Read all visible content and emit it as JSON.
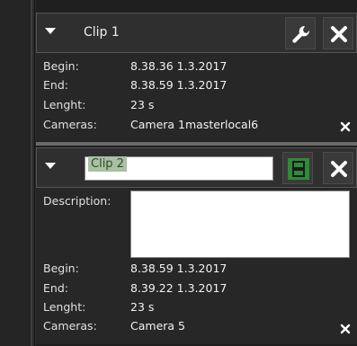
{
  "clips": [
    {
      "title": "Clip 1",
      "begin_label": "Begin:",
      "begin_value": "8.38.36 1.3.2017",
      "end_label": "End:",
      "end_value": "8.38.59 1.3.2017",
      "length_label": "Lenght:",
      "length_value": "23 s",
      "cameras_label": "Cameras:",
      "cameras_value": "Camera 1masterlocal6"
    },
    {
      "title_input_value": "Clip 2",
      "description_label": "Description:",
      "description_value": "",
      "begin_label": "Begin:",
      "begin_value": "8.38.59 1.3.2017",
      "end_label": "End:",
      "end_value": "8.39.22 1.3.2017",
      "length_label": "Lenght:",
      "length_value": "23 s",
      "cameras_label": "Cameras:",
      "cameras_value": "Camera 5"
    }
  ],
  "icons": {
    "chevron": "chevron-down-icon",
    "wrench": "wrench-icon",
    "save": "save-icon",
    "close": "close-icon"
  },
  "colors": {
    "background": "#2b2b2b",
    "panel": "#272727",
    "header": "#2f2f2f",
    "save_accent": "#2f8a3a",
    "text": "#e6e6e6"
  }
}
